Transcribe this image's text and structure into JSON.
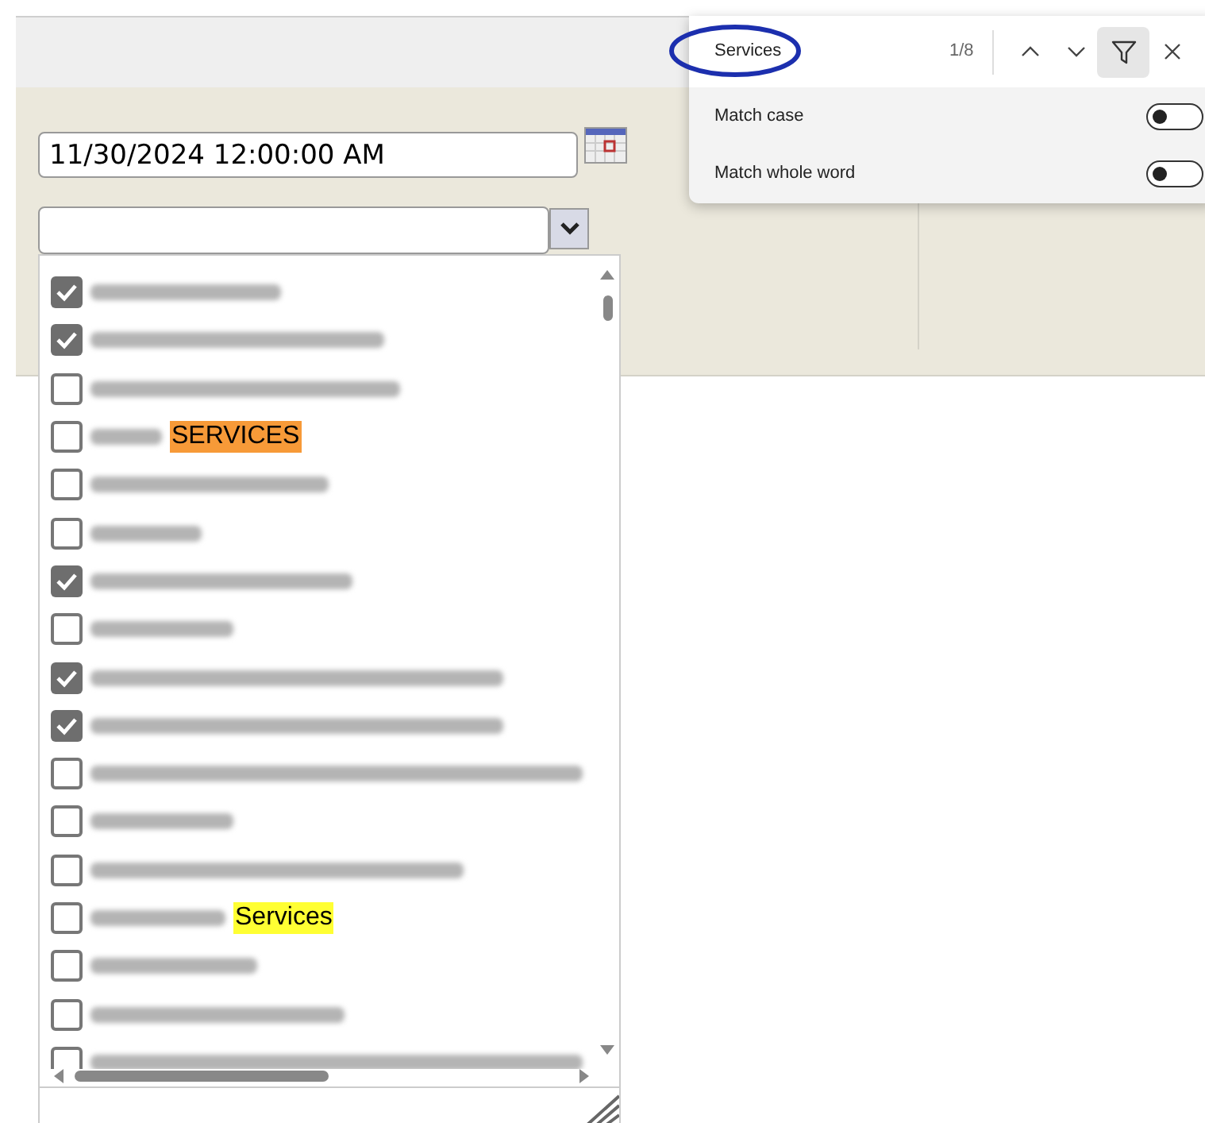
{
  "find_bar": {
    "query": "Services",
    "match_count": "1/8",
    "filter_active": true,
    "options": [
      {
        "label": "Match case",
        "on": false
      },
      {
        "label": "Match whole word",
        "on": false
      }
    ]
  },
  "date_field": {
    "value": "11/30/2024 12:00:00 AM"
  },
  "provider_list": {
    "items": [
      {
        "checked": true
      },
      {
        "checked": true
      },
      {
        "checked": false
      },
      {
        "checked": false,
        "highlight": {
          "text": "SERVICES",
          "current": true
        }
      },
      {
        "checked": false
      },
      {
        "checked": false
      },
      {
        "checked": true
      },
      {
        "checked": false
      },
      {
        "checked": true
      },
      {
        "checked": true
      },
      {
        "checked": false
      },
      {
        "checked": false
      },
      {
        "checked": false
      },
      {
        "checked": false,
        "highlight": {
          "text": "Services",
          "current": false
        }
      },
      {
        "checked": false
      },
      {
        "checked": false
      },
      {
        "checked": false
      }
    ]
  }
}
